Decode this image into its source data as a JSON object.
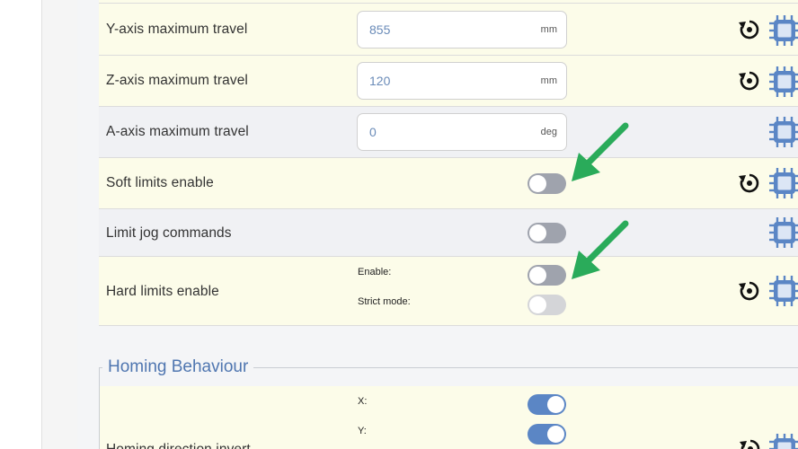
{
  "settings": [
    {
      "label": "Y-axis maximum travel",
      "value": "855",
      "unit": "mm",
      "has_reset": true
    },
    {
      "label": "Z-axis maximum travel",
      "value": "120",
      "unit": "mm",
      "has_reset": true
    },
    {
      "label": "A-axis maximum travel",
      "value": "0",
      "unit": "deg",
      "has_reset": false
    },
    {
      "label": "Soft limits enable",
      "toggle_on": false,
      "has_reset": true
    },
    {
      "label": "Limit jog commands",
      "toggle_on": false,
      "has_reset": false
    },
    {
      "label": "Hard limits enable",
      "sub": [
        {
          "label": "Enable:",
          "toggle_on": false
        },
        {
          "label": "Strict mode:",
          "toggle_on": false,
          "disabled": true
        }
      ],
      "has_reset": true
    }
  ],
  "homing": {
    "section_title": "Homing Behaviour",
    "row_label": "Homing direction invert",
    "sub": [
      {
        "label": "X:",
        "toggle_on": true
      },
      {
        "label": "Y:",
        "toggle_on": true
      }
    ]
  },
  "colors": {
    "accent": "#5b86c5",
    "annotation_arrow": "#2aab5a",
    "chip": "#5b86c5"
  },
  "icons": {
    "reset": "reset-icon",
    "controller": "chip-icon",
    "annotation": "arrow-annotation-icon"
  }
}
